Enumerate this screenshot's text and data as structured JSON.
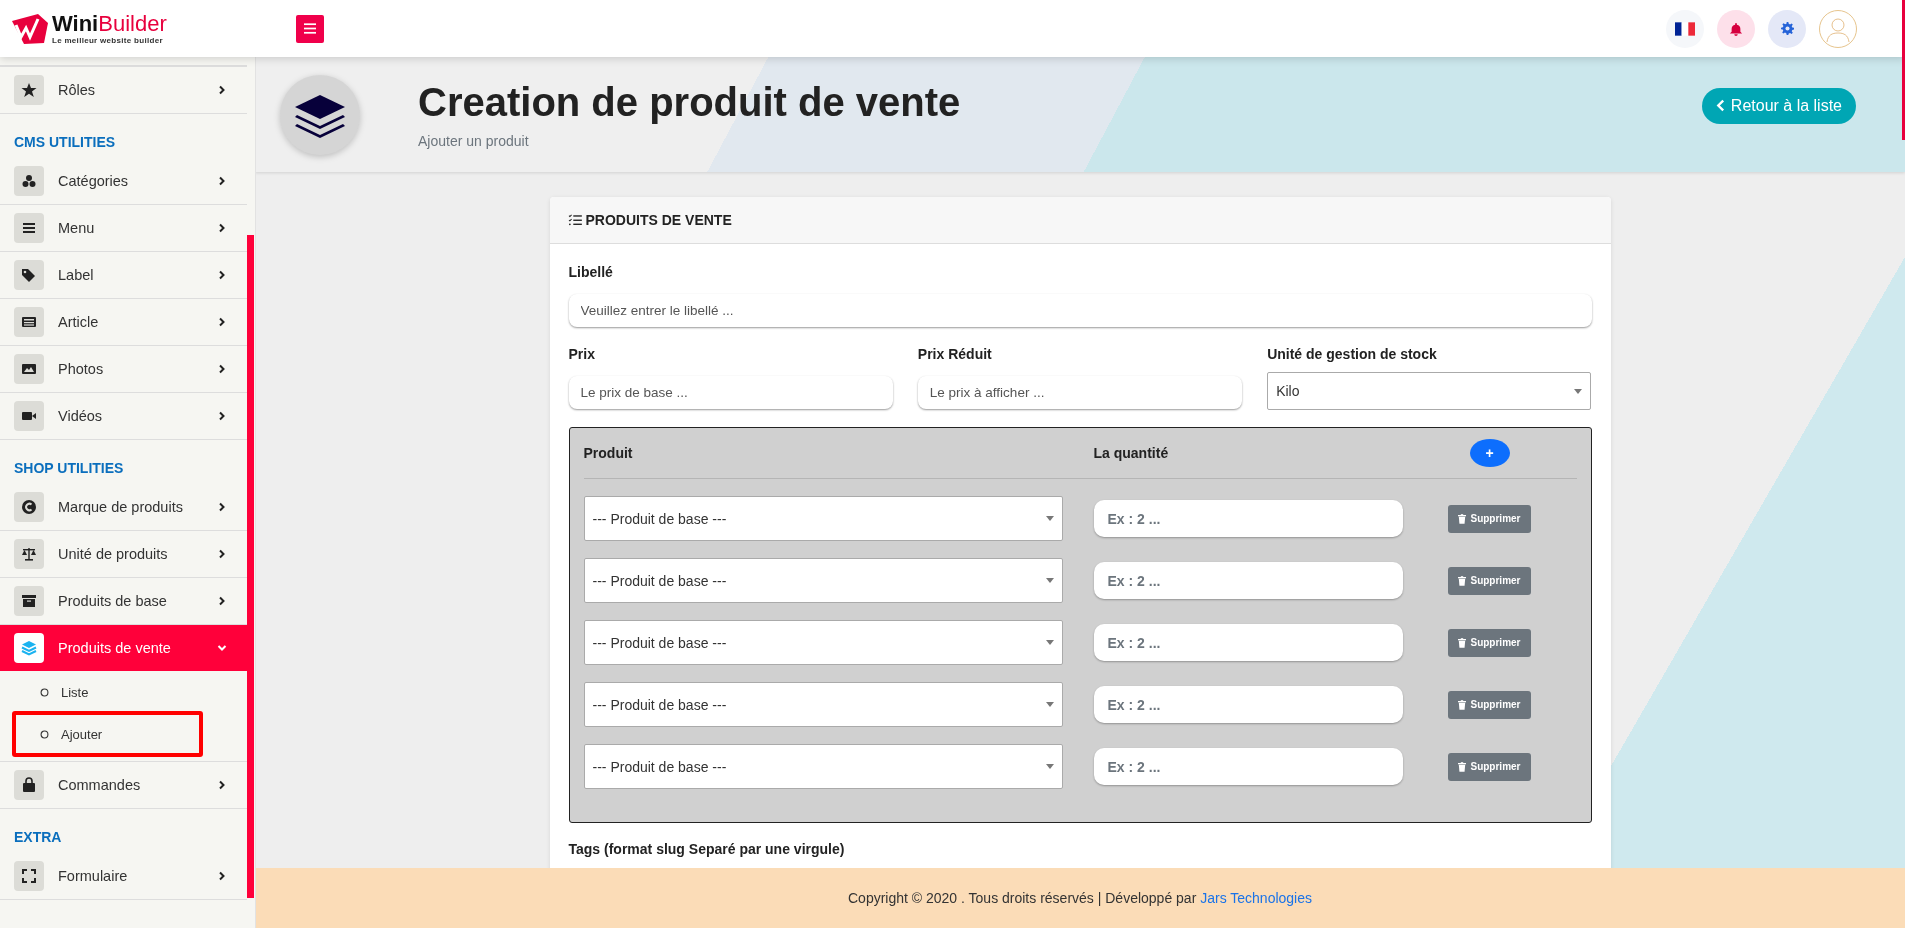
{
  "header": {
    "logo": {
      "name_dark": "Wini",
      "name_accent": "Builder",
      "tagline": "Le meilleur website builder"
    }
  },
  "sidebar": {
    "sections": [
      {
        "items": [
          {
            "label": "Rôles",
            "selected": false,
            "expanded": false
          }
        ]
      },
      {
        "title": "CMS UTILITIES",
        "items": [
          {
            "label": "Catégories",
            "selected": false,
            "expanded": false
          },
          {
            "label": "Menu",
            "selected": false,
            "expanded": false
          },
          {
            "label": "Label",
            "selected": false,
            "expanded": false
          },
          {
            "label": "Article",
            "selected": false,
            "expanded": false
          },
          {
            "label": "Photos",
            "selected": false,
            "expanded": false
          },
          {
            "label": "Vidéos",
            "selected": false,
            "expanded": false
          }
        ]
      },
      {
        "title": "SHOP UTILITIES",
        "items": [
          {
            "label": "Marque de produits",
            "selected": false,
            "expanded": false
          },
          {
            "label": "Unité de produits",
            "selected": false,
            "expanded": false
          },
          {
            "label": "Produits de base",
            "selected": false,
            "expanded": false
          },
          {
            "label": "Produits de vente",
            "selected": true,
            "expanded": true,
            "children": [
              {
                "label": "Liste",
                "highlighted": false
              },
              {
                "label": "Ajouter",
                "highlighted": true
              }
            ]
          },
          {
            "label": "Commandes",
            "selected": false,
            "expanded": false
          }
        ]
      },
      {
        "title": "EXTRA",
        "items": [
          {
            "label": "Formulaire",
            "selected": false,
            "expanded": false
          }
        ]
      }
    ]
  },
  "page_header": {
    "title": "Creation de produit de vente",
    "subtitle": "Ajouter un produit",
    "back_button": "Retour à la liste"
  },
  "card": {
    "title": "PRODUITS DE VENTE",
    "libelle": {
      "label": "Libellé",
      "placeholder": "Veuillez entrer le libellé ..."
    },
    "price_fields": [
      {
        "label": "Prix",
        "placeholder": "Le prix de base ..."
      },
      {
        "label": "Prix Réduit",
        "placeholder": "Le prix à afficher ..."
      }
    ],
    "stock_unit": {
      "label": "Unité de gestion de stock",
      "value": "Kilo"
    },
    "components": {
      "columns": [
        "Produit",
        "La quantité"
      ],
      "add_button": "+",
      "rows": [
        {
          "product": "--- Produit de base ---",
          "quantity_placeholder": "Ex : 2 ...",
          "delete_button": "Supprimer"
        },
        {
          "product": "--- Produit de base ---",
          "quantity_placeholder": "Ex : 2 ...",
          "delete_button": "Supprimer"
        },
        {
          "product": "--- Produit de base ---",
          "quantity_placeholder": "Ex : 2 ...",
          "delete_button": "Supprimer"
        },
        {
          "product": "--- Produit de base ---",
          "quantity_placeholder": "Ex : 2 ...",
          "delete_button": "Supprimer"
        },
        {
          "product": "--- Produit de base ---",
          "quantity_placeholder": "Ex : 2 ...",
          "delete_button": "Supprimer"
        }
      ]
    },
    "tags_label": "Tags (format slug Separé par une virgule)"
  },
  "footer": {
    "text": "Copyright © 2020 . Tous droits réservés | Développé par ",
    "link": "Jars Technologies"
  }
}
